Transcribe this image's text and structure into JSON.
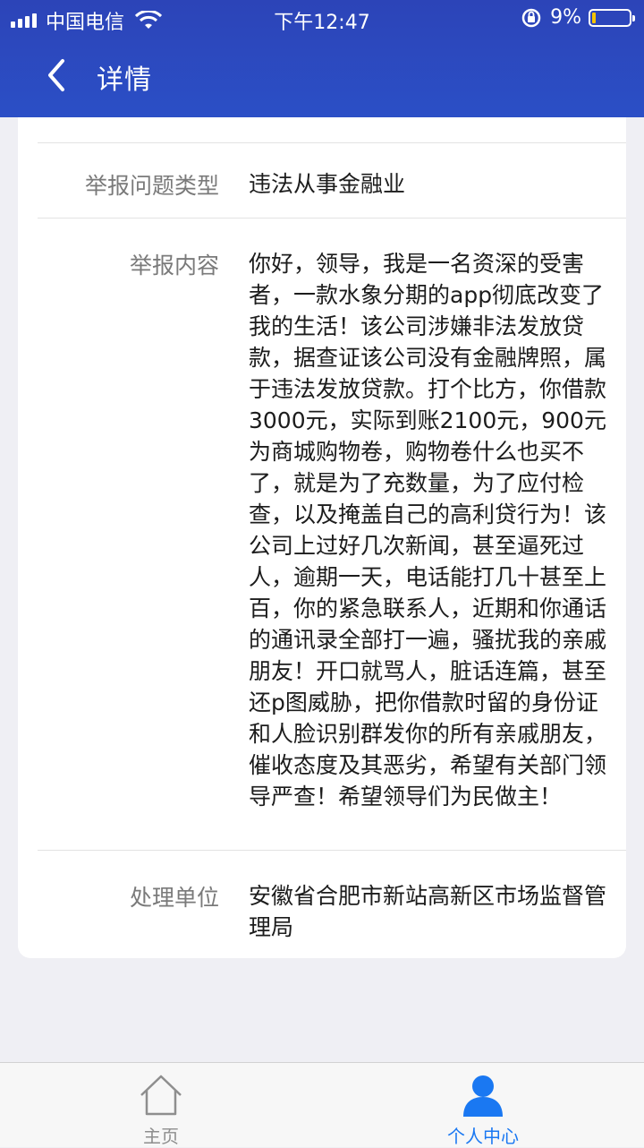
{
  "status_bar": {
    "carrier": "中国电信",
    "time": "下午12:47",
    "battery_percent": "9%",
    "battery_level": 0.09
  },
  "navbar": {
    "title": "详情",
    "back_icon": "chevron-left-icon"
  },
  "details": [
    {
      "label": "举报问题类型",
      "value": "违法从事金融业"
    },
    {
      "label": "举报内容",
      "value": "你好，领导，我是一名资深的受害者，一款水象分期的app彻底改变了我的生活！该公司涉嫌非法发放贷款，据查证该公司没有金融牌照，属于违法发放贷款。打个比方，你借款3000元，实际到账2100元，900元为商城购物卷，购物卷什么也买不了，就是为了充数量，为了应付检查，以及掩盖自己的高利贷行为！该公司上过好几次新闻，甚至逼死过人，逾期一天，电话能打几十甚至上百，你的紧急联系人，近期和你通话的通讯录全部打一遍，骚扰我的亲戚朋友！开口就骂人，脏话连篇，甚至还p图威胁，把你借款时留的身份证和人脸识别群发你的所有亲戚朋友，催收态度及其恶劣，希望有关部门领导严查！希望领导们为民做主！"
    },
    {
      "label": "处理单位",
      "value": "安徽省合肥市新站高新区市场监督管理局"
    }
  ],
  "tabbar": {
    "tabs": [
      {
        "label": "主页",
        "icon": "home-icon",
        "active": false
      },
      {
        "label": "个人中心",
        "icon": "person-icon",
        "active": true
      }
    ]
  },
  "colors": {
    "header": "#2b47bf",
    "active_tab": "#1a78f2",
    "inactive_tab": "#8e8e8e"
  }
}
